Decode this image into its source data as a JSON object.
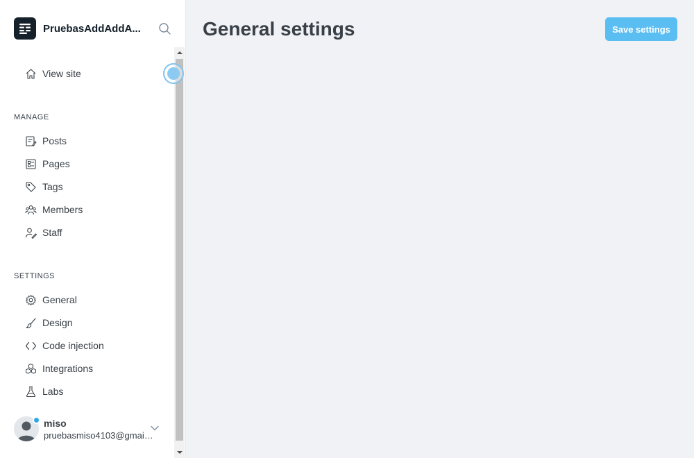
{
  "sidebar": {
    "site_name": "PruebasAddAddA...",
    "view_site_label": "View site",
    "manage_label": "MANAGE",
    "manage_items": [
      {
        "label": "Posts",
        "icon": "posts-icon"
      },
      {
        "label": "Pages",
        "icon": "pages-icon"
      },
      {
        "label": "Tags",
        "icon": "tag-icon"
      },
      {
        "label": "Members",
        "icon": "members-icon"
      },
      {
        "label": "Staff",
        "icon": "staff-icon"
      }
    ],
    "settings_label": "SETTINGS",
    "settings_items": [
      {
        "label": "General",
        "icon": "gear-icon"
      },
      {
        "label": "Design",
        "icon": "brush-icon"
      },
      {
        "label": "Code injection",
        "icon": "code-icon"
      },
      {
        "label": "Integrations",
        "icon": "integrations-icon"
      },
      {
        "label": "Labs",
        "icon": "flask-icon"
      }
    ]
  },
  "user": {
    "name": "miso",
    "email": "pruebasmiso4103@gmail...."
  },
  "main": {
    "title": "General settings",
    "save_label": "Save settings"
  },
  "colors": {
    "accent": "#5bbef3",
    "background": "#f1f2f6",
    "status_dot": "#30a5e7"
  }
}
